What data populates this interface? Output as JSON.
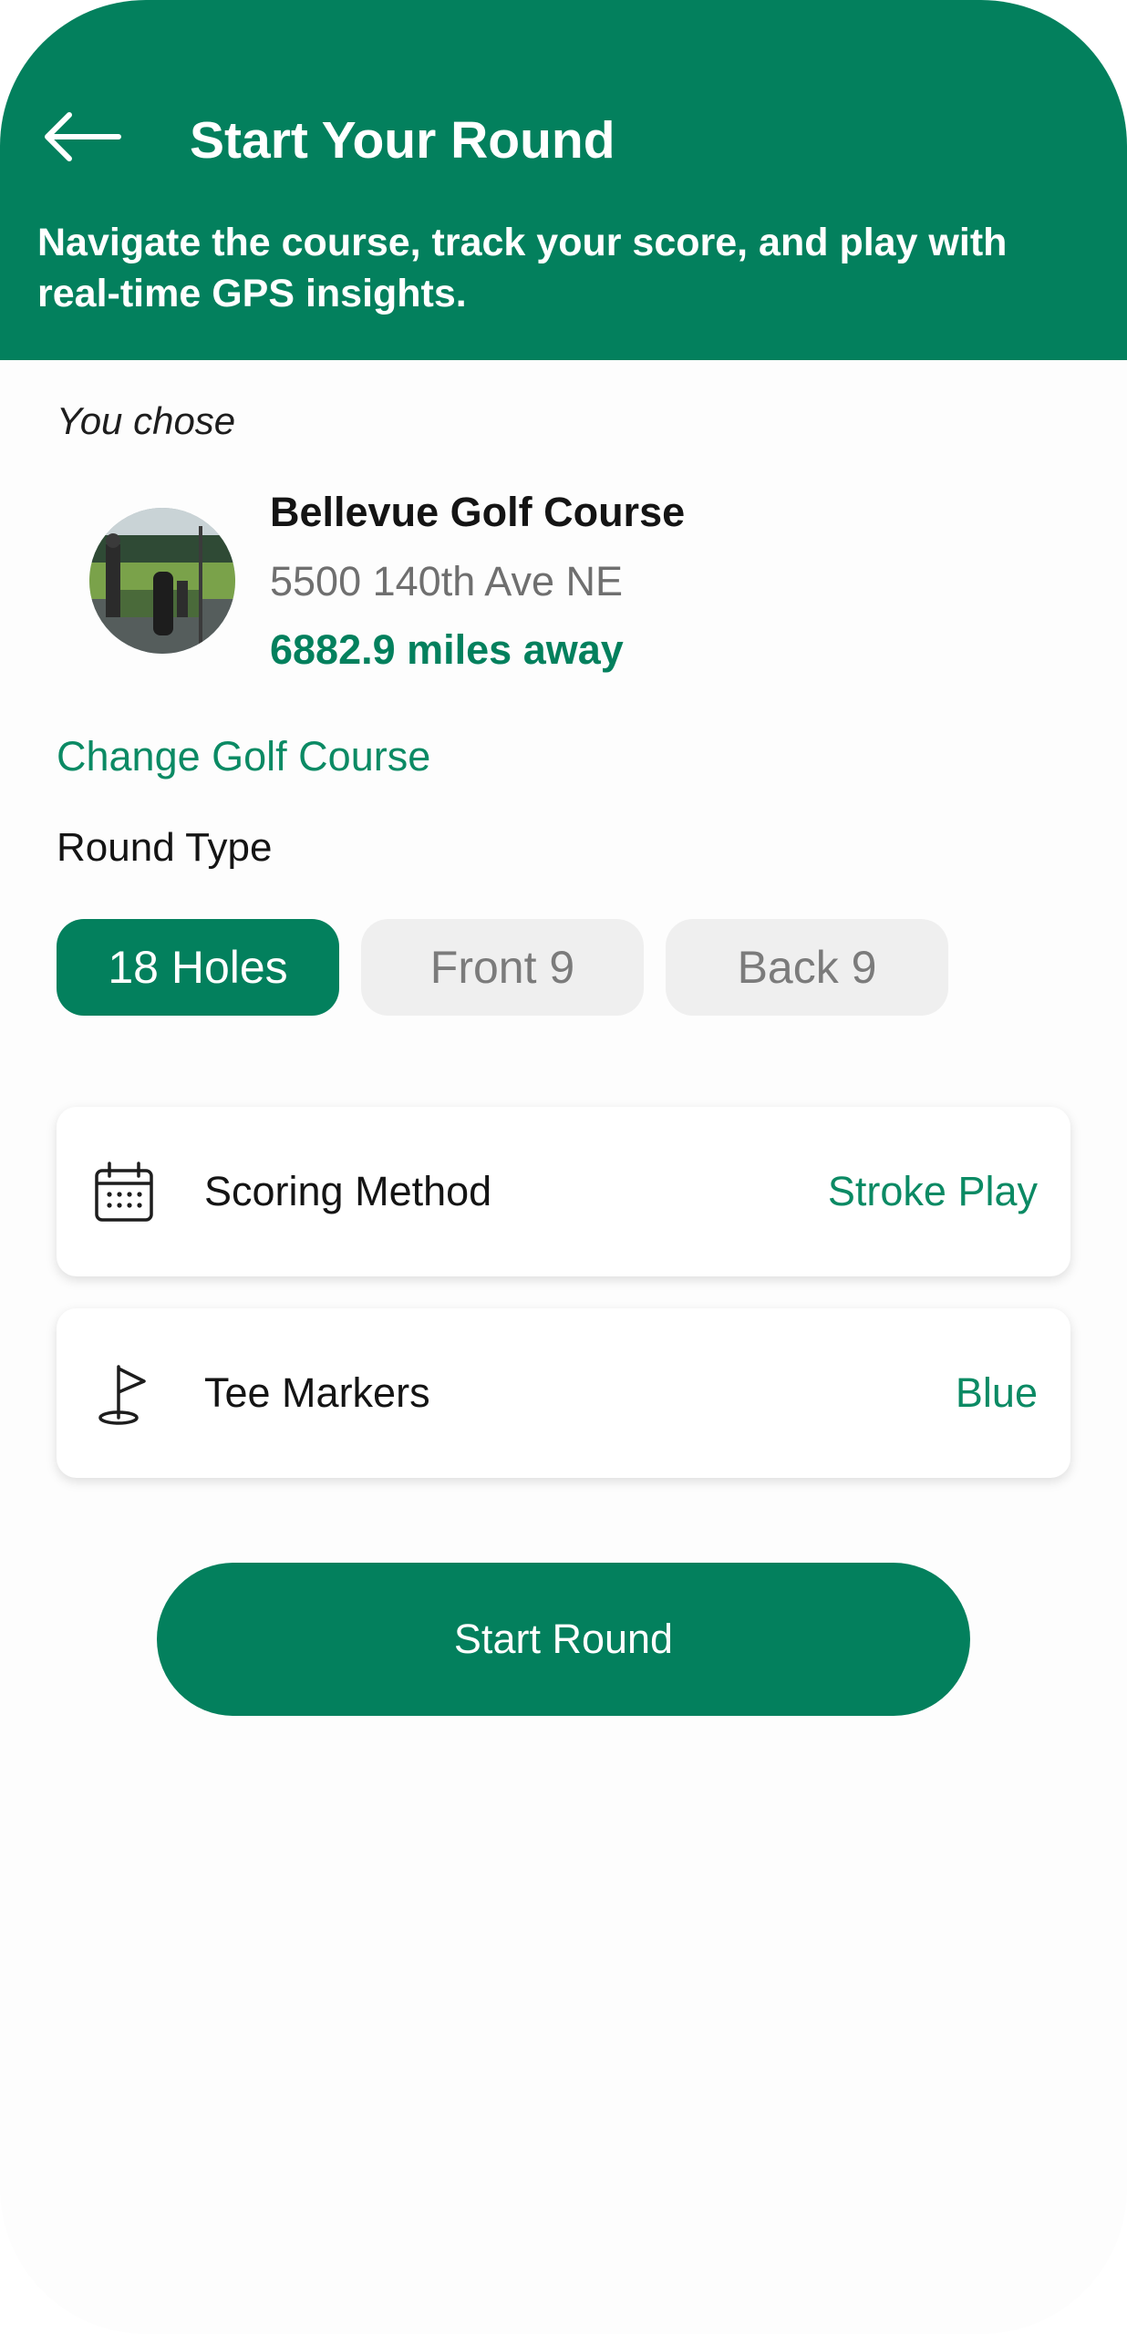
{
  "header": {
    "title": "Start Your Round",
    "subtitle": "Navigate the course, track your score, and play with real-time GPS insights."
  },
  "selection": {
    "intro": "You chose",
    "course_name": "Bellevue Golf Course",
    "address": "5500 140th Ave NE",
    "distance": "6882.9 miles away",
    "change_label": "Change Golf Course"
  },
  "round_type": {
    "label": "Round Type",
    "options": [
      "18 Holes",
      "Front 9",
      "Back 9"
    ],
    "selected": "18 Holes"
  },
  "settings": [
    {
      "label": "Scoring Method",
      "value": "Stroke Play",
      "icon": "calendar-icon"
    },
    {
      "label": "Tee Markers",
      "value": "Blue",
      "icon": "golf-flag-icon"
    }
  ],
  "actions": {
    "start_label": "Start Round"
  },
  "colors": {
    "brand_green": "#03805d",
    "accent_text": "#0b8a64",
    "pill_inactive": "#efefef"
  }
}
